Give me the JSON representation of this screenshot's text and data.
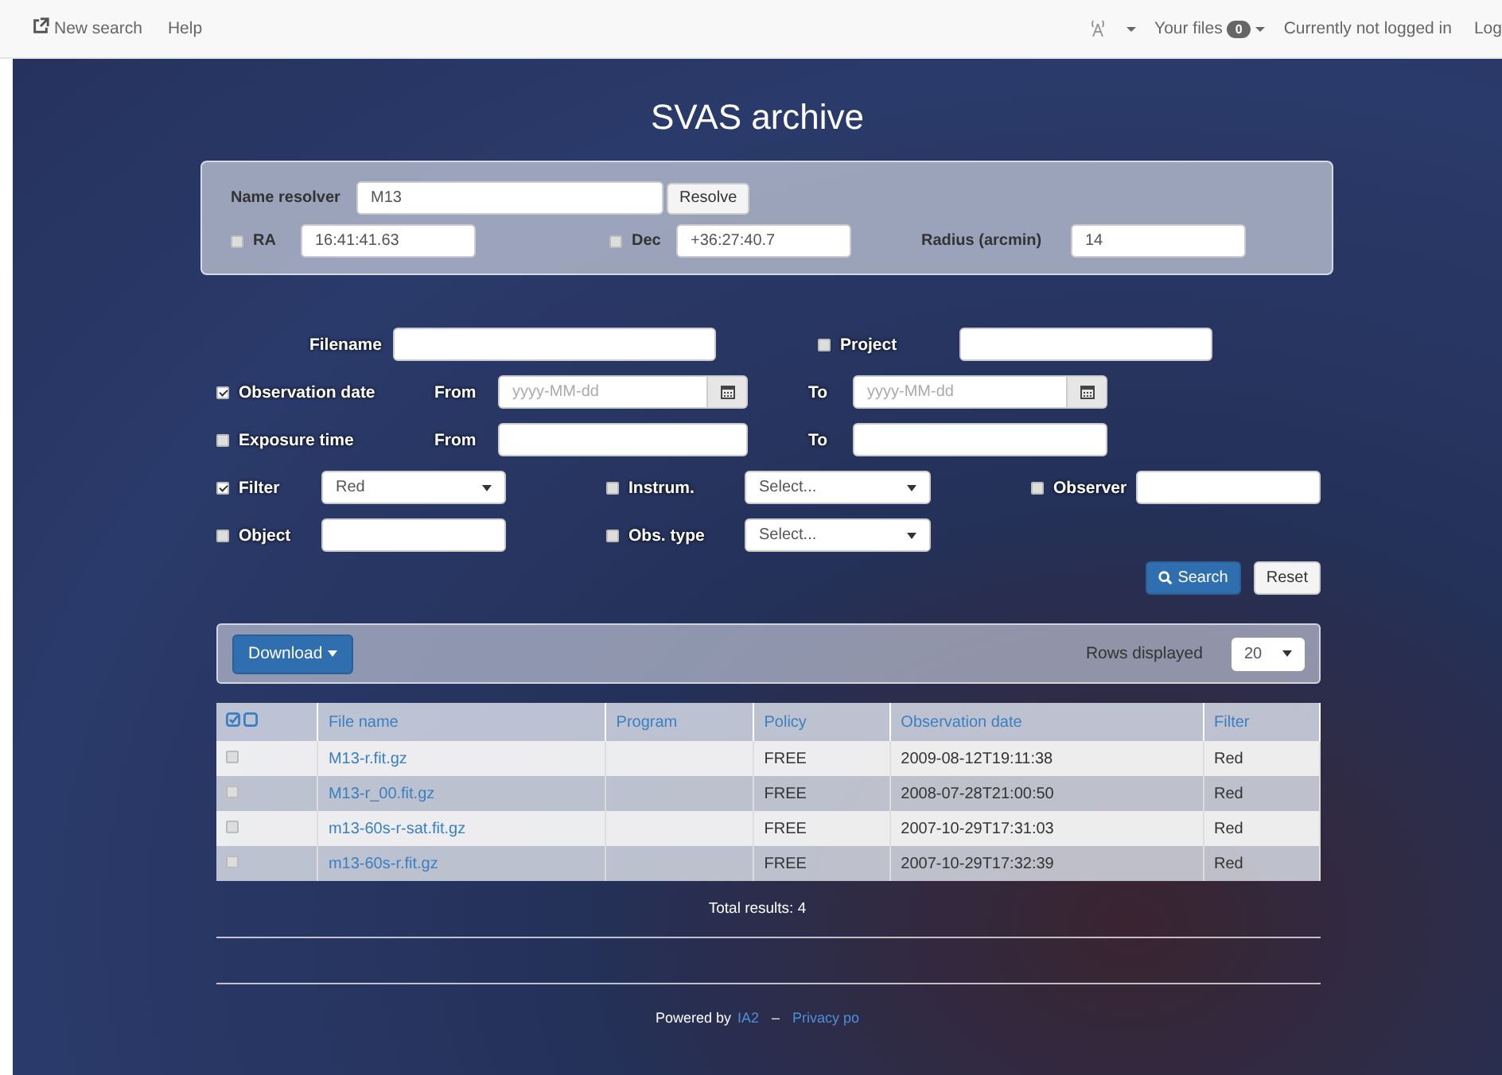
{
  "navbar": {
    "links": [
      {
        "label": "New search",
        "kind": "new"
      },
      {
        "label": "Help",
        "kind": "plain"
      }
    ],
    "files": {
      "label": "Your files",
      "count": "0"
    },
    "login_status": "Currently not logged in",
    "login_link": "Log"
  },
  "title": "SVAS archive",
  "resolver": {
    "label": "Name resolver",
    "value": "M13",
    "button": "Resolve",
    "ra": {
      "label": "RA",
      "checked": false,
      "value": "16:41:41.63"
    },
    "dec": {
      "label": "Dec",
      "checked": false,
      "value": "+36:27:40.7"
    },
    "radius": {
      "label": "Radius (arcmin)",
      "value": "14"
    }
  },
  "search": {
    "filename": {
      "label": "Filename"
    },
    "project": {
      "label": "Project",
      "checked": false
    },
    "observation_date": {
      "label": "Observation date",
      "checked": true,
      "from_label": "From",
      "from_placeholder": "yyyy-MM-dd",
      "to_label": "To",
      "to_placeholder": "yyyy-MM-dd"
    },
    "exposure_time": {
      "label": "Exposure time",
      "checked": false,
      "from_label": "From",
      "to_label": "To"
    },
    "filter": {
      "label": "Filter",
      "checked": true,
      "value": "Red"
    },
    "instrument": {
      "label": "Instrum.",
      "checked": false,
      "value": "Select..."
    },
    "observer": {
      "label": "Observer",
      "checked": false
    },
    "object": {
      "label": "Object",
      "checked": false
    },
    "obs_type": {
      "label": "Obs. type",
      "checked": false,
      "value": "Select..."
    },
    "search_button": "Search",
    "reset_button": "Reset"
  },
  "results": {
    "download_button": "Download",
    "rows_label": "Rows displayed",
    "rows_value": "20",
    "columns": [
      "File name",
      "Program",
      "Policy",
      "Observation date",
      "Filter"
    ],
    "rows": [
      {
        "checked": false,
        "cells": [
          "M13-r.fit.gz",
          "",
          "FREE",
          "2009-08-12T19:11:38",
          "Red"
        ]
      },
      {
        "checked": false,
        "cells": [
          "M13-r_00.fit.gz",
          "",
          "FREE",
          "2008-07-28T21:00:50",
          "Red"
        ]
      },
      {
        "checked": false,
        "cells": [
          "m13-60s-r-sat.fit.gz",
          "",
          "FREE",
          "2007-10-29T17:31:03",
          "Red"
        ]
      },
      {
        "checked": false,
        "cells": [
          "m13-60s-r.fit.gz",
          "",
          "FREE",
          "2007-10-29T17:32:39",
          "Red"
        ]
      }
    ],
    "total": "Total results: 4"
  },
  "footer": {
    "powered_by": "Powered by",
    "link": "IA2",
    "separator": "–",
    "privacy_link": "Privacy po"
  }
}
